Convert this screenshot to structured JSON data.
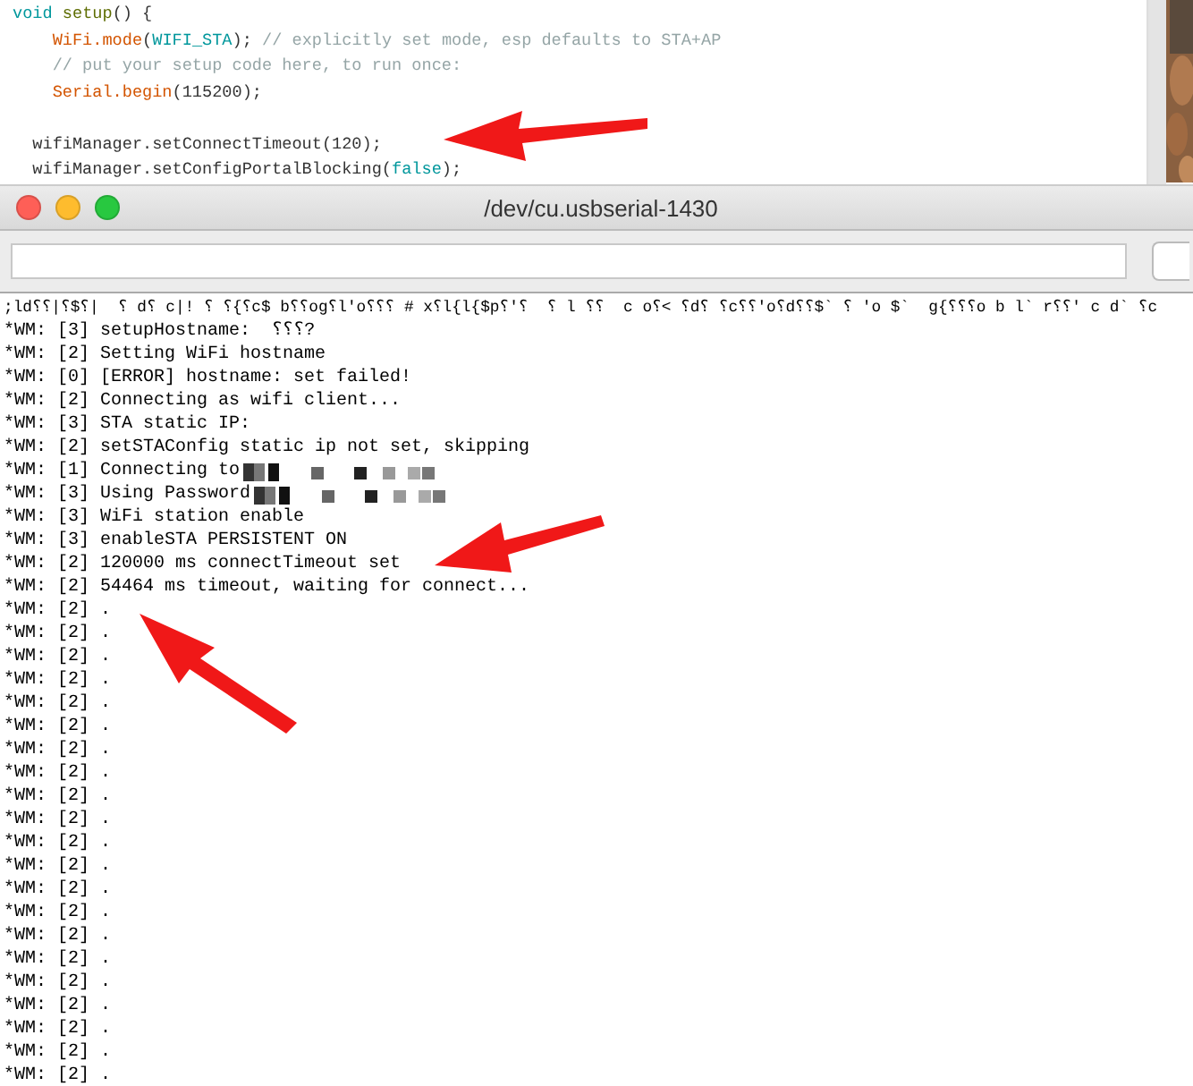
{
  "editor": {
    "lines": [
      {
        "kind": "top",
        "segments": [
          {
            "text": "void ",
            "kind": "keyword"
          },
          {
            "text": "setup",
            "kind": "function"
          },
          {
            "text": "() {",
            "kind": "plain"
          }
        ]
      },
      {
        "kind": "inner",
        "segments": [
          {
            "text": "WiFi.mode",
            "kind": "method"
          },
          {
            "text": "(",
            "kind": "plain"
          },
          {
            "text": "WIFI_STA",
            "kind": "keyword"
          },
          {
            "text": "); ",
            "kind": "plain"
          },
          {
            "text": "// explicitly set mode, esp defaults to STA+AP",
            "kind": "comment"
          }
        ]
      },
      {
        "kind": "inner",
        "segments": [
          {
            "text": "// put your setup code here, to run once:",
            "kind": "comment"
          }
        ]
      },
      {
        "kind": "inner",
        "segments": [
          {
            "text": "Serial.begin",
            "kind": "method"
          },
          {
            "text": "(115200);",
            "kind": "plain"
          }
        ]
      },
      {
        "kind": "block_after_blank",
        "segments": [
          {
            "text": "wifiManager.setConnectTimeout(120);",
            "kind": "plain"
          }
        ]
      },
      {
        "kind": "block",
        "segments": [
          {
            "text": "wifiManager.setConfigPortalBlocking(",
            "kind": "plain"
          },
          {
            "text": "false",
            "kind": "keyword"
          },
          {
            "text": ");",
            "kind": "plain"
          }
        ]
      }
    ]
  },
  "serial_window": {
    "title": "/dev/cu.usbserial-1430",
    "console": [
      {
        "kind": "garbled",
        "text": ";ld⸮⸮|⸮$⸮|  ⸮ d⸮ c|! ⸮ ⸮{⸮c$ b⸮⸮og⸮l'o⸮⸮⸮ # x⸮l{l{$p⸮'⸮  ⸮ l ⸮⸮  c o⸮< ⸮d⸮ ⸮c⸮⸮'o⸮d⸮⸮$` ⸮ 'o $`  g{⸮⸮⸮o b l` r⸮⸮' c d` ⸮c"
      },
      {
        "kind": "log",
        "text": "*WM: [3] setupHostname:  ⸮⸮⸮?"
      },
      {
        "kind": "log",
        "text": "*WM: [2] Setting WiFi hostname"
      },
      {
        "kind": "log",
        "text": "*WM: [0] [ERROR] hostname: set failed!"
      },
      {
        "kind": "log",
        "text": "*WM: [2] Connecting as wifi client..."
      },
      {
        "kind": "log",
        "text": "*WM: [3] STA static IP:"
      },
      {
        "kind": "log",
        "text": "*WM: [2] setSTAConfig static ip not set, skipping"
      },
      {
        "kind": "redacted",
        "text": "*WM: [1] Connecting to"
      },
      {
        "kind": "redacted",
        "text": "*WM: [3] Using Password"
      },
      {
        "kind": "log",
        "text": "*WM: [3] WiFi station enable"
      },
      {
        "kind": "log",
        "text": "*WM: [3] enableSTA PERSISTENT ON"
      },
      {
        "kind": "log",
        "text": "*WM: [2] 120000 ms connectTimeout set"
      },
      {
        "kind": "log",
        "text": "*WM: [2] 54464 ms timeout, waiting for connect..."
      },
      {
        "kind": "log",
        "text": "*WM: [2] ."
      },
      {
        "kind": "log",
        "text": "*WM: [2] ."
      },
      {
        "kind": "log",
        "text": "*WM: [2] ."
      },
      {
        "kind": "log",
        "text": "*WM: [2] ."
      },
      {
        "kind": "log",
        "text": "*WM: [2] ."
      },
      {
        "kind": "log",
        "text": "*WM: [2] ."
      },
      {
        "kind": "log",
        "text": "*WM: [2] ."
      },
      {
        "kind": "log",
        "text": "*WM: [2] ."
      },
      {
        "kind": "log",
        "text": "*WM: [2] ."
      },
      {
        "kind": "log",
        "text": "*WM: [2] ."
      },
      {
        "kind": "log",
        "text": "*WM: [2] ."
      },
      {
        "kind": "log",
        "text": "*WM: [2] ."
      },
      {
        "kind": "log",
        "text": "*WM: [2] ."
      },
      {
        "kind": "log",
        "text": "*WM: [2] ."
      },
      {
        "kind": "log",
        "text": "*WM: [2] ."
      },
      {
        "kind": "log",
        "text": "*WM: [2] ."
      },
      {
        "kind": "log",
        "text": "*WM: [2] ."
      },
      {
        "kind": "log",
        "text": "*WM: [2] ."
      },
      {
        "kind": "log",
        "text": "*WM: [2] ."
      },
      {
        "kind": "log",
        "text": "*WM: [2] ."
      },
      {
        "kind": "log",
        "text": "*WM: [2] ."
      }
    ]
  }
}
